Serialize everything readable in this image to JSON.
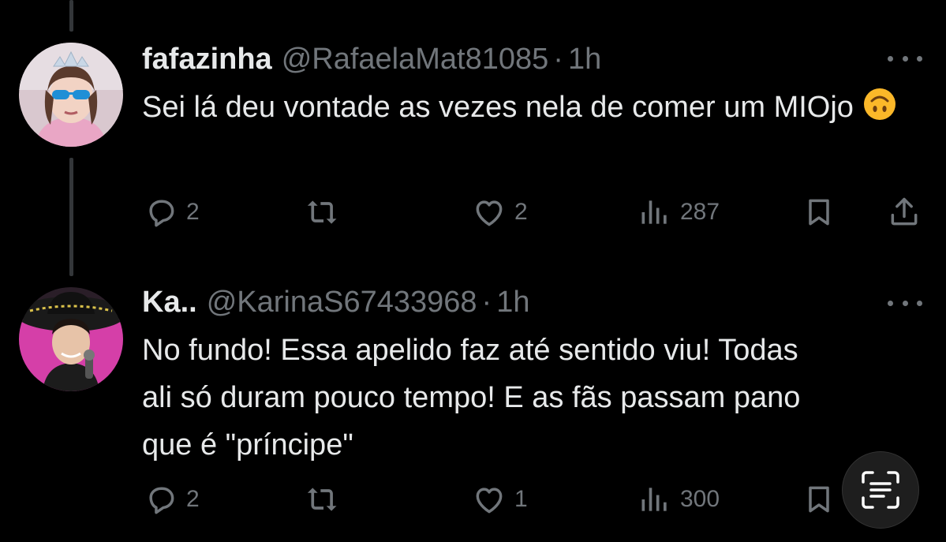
{
  "tweets": [
    {
      "name": "fafazinha",
      "handle": "@RafaelaMat81085",
      "separator": "·",
      "time": "1h",
      "text": "Sei lá deu vontade as vezes nela de comer um MIOjo",
      "emoji": "upside-down-face",
      "stats": {
        "replies": "2",
        "likes": "2",
        "views": "287"
      }
    },
    {
      "name": "Ka..",
      "handle": "@KarinaS67433968",
      "separator": "·",
      "time": "1h",
      "text": "No fundo! Essa apelido faz até sentido viu! Todas ali só duram pouco tempo! E as fãs passam pano que é \"príncipe\"",
      "stats": {
        "replies": "2",
        "likes": "1",
        "views": "300"
      }
    }
  ],
  "icons": [
    "reply-icon",
    "retweet-icon",
    "like-icon",
    "views-icon",
    "bookmark-icon",
    "share-icon",
    "more-icon",
    "text-scan-icon"
  ],
  "colors": {
    "background": "#000000",
    "text": "#e7e9ea",
    "muted": "#71767b",
    "thread_line": "#333639"
  }
}
